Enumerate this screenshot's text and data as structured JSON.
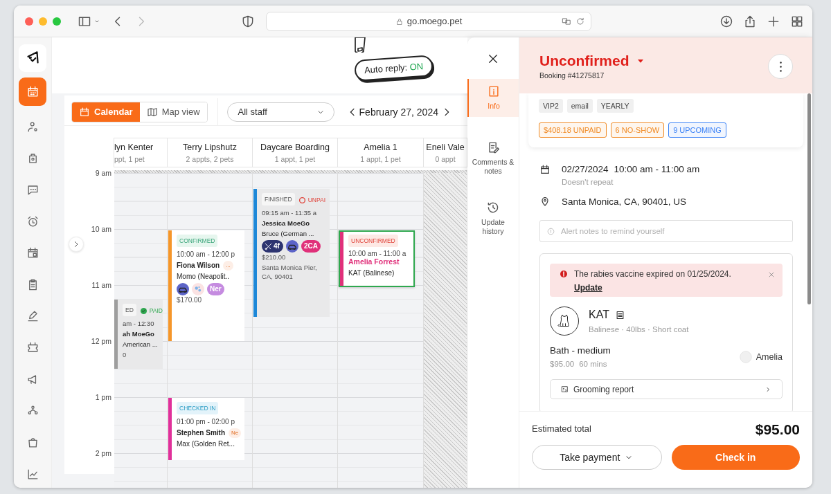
{
  "browser": {
    "url": "go.moego.pet"
  },
  "sidebar": {
    "items": [
      {
        "selected": true
      },
      {
        "selected": false
      },
      {
        "selected": false
      },
      {
        "selected": false
      },
      {
        "selected": false
      },
      {
        "selected": false
      },
      {
        "selected": false
      },
      {
        "selected": false
      },
      {
        "selected": false
      },
      {
        "selected": false
      },
      {
        "selected": false
      },
      {
        "selected": false
      },
      {
        "selected": false
      }
    ]
  },
  "auto_reply": {
    "label": "Auto reply:",
    "value": "ON",
    "on": true
  },
  "calendar": {
    "views": [
      {
        "label": "Calendar",
        "selected": true
      },
      {
        "label": "Map view",
        "selected": false
      }
    ],
    "staff_filter": "All staff",
    "date": "February 27, 2024",
    "hours": [
      "9 am",
      "10 am",
      "11 am",
      "12 pm",
      "1 pm",
      "2 pm"
    ],
    "columns": [
      {
        "name": "lyn Kenter",
        "summary": "ppt, 1 pet",
        "available": true,
        "events": [
          {
            "kind": "finished",
            "selected": false,
            "color": "#9e9e9e",
            "status": "ED",
            "payment": {
              "label": "PAID",
              "paid": true
            },
            "time": "am - 12:30",
            "client": "ah MoeGo",
            "highlight": false,
            "pet": "American ...",
            "price": "0"
          }
        ]
      },
      {
        "name": "Terry Lipshutz",
        "summary": "2 appts, 2 pets",
        "available": true,
        "events": [
          {
            "kind": "confirmed",
            "selected": false,
            "color": "#f5962a",
            "status": "CONFIRMED",
            "time": "10:00 am - 12:00 p",
            "client": "Fiona Wilson",
            "highlight": false,
            "client_tag": "...",
            "pet": "Momo (Neapolit..",
            "chips": [
              {
                "kind": "car"
              },
              {
                "kind": "bubbles"
              },
              {
                "kind": "tag",
                "label": "Ner",
                "color": "#c58be0"
              }
            ],
            "price": "$170.00"
          },
          {
            "kind": "checked_in",
            "selected": false,
            "color": "#e0309a",
            "status": "CHECKED IN",
            "time": "01:00 pm - 02:00 p",
            "client": "Stephen Smith",
            "highlight": false,
            "client_tag": "Ne",
            "pet": "Max (Golden Ret..."
          }
        ]
      },
      {
        "name": "Daycare Boarding",
        "summary": "1 appt, 1 pet",
        "available": true,
        "events": [
          {
            "kind": "finished",
            "selected": false,
            "color": "#1e88d8",
            "status": "FINISHED",
            "payment": {
              "label": "UNPAI",
              "paid": false
            },
            "time": "09:15 am - 11:35 a",
            "client": "Jessica MoeGo",
            "highlight": false,
            "pet": "Bruce (German ...",
            "chips": [
              {
                "kind": "groom",
                "label": "4f"
              },
              {
                "kind": "car"
              },
              {
                "kind": "tag",
                "label": "2CA",
                "color": "#e0307a"
              }
            ],
            "price": "$210.00",
            "address": "Santa Monica Pier, CA, 90401"
          }
        ]
      },
      {
        "name": "Amelia 1",
        "summary": "1 appt, 1 pet",
        "available": true,
        "events": [
          {
            "kind": "unconfirmed",
            "selected": true,
            "color": "#e0307a",
            "status": "UNCONFIRMED",
            "time": "10:00 am - 11:00 a",
            "client": "Amelia Forrest",
            "highlight": true,
            "pet": "KAT (Balinese)"
          }
        ]
      },
      {
        "name": "Eneli Vale",
        "summary": "0 appt",
        "available": false
      }
    ]
  },
  "drawer": {
    "tabs": [
      {
        "label": "Info",
        "selected": true
      },
      {
        "label": "Comments & notes",
        "selected": false
      },
      {
        "label": "Update history",
        "selected": false
      }
    ],
    "status": "Unconfirmed",
    "booking": "Booking #41275817",
    "client_tags": [
      "VIP2",
      "email",
      "YEARLY"
    ],
    "badges": [
      {
        "label": "$408.18 UNPAID",
        "color": "#f08a24"
      },
      {
        "label": "6 NO-SHOW",
        "color": "#f08a24"
      },
      {
        "label": "9 UPCOMING",
        "color": "#3b82f6"
      }
    ],
    "date": "02/27/2024",
    "time": "10:00 am - 11:00 am",
    "repeat": "Doesn't repeat",
    "location": "Santa Monica, CA, 90401, US",
    "alert_notes": {
      "placeholder": "Alert notes to remind yourself"
    },
    "pet": {
      "alert": "The rabies vaccine expired on 01/25/2024.",
      "alert_link": "Update",
      "name": "KAT",
      "details": "Balinese · 40lbs · Short coat",
      "service": "Bath - medium",
      "price": "$95.00",
      "duration": "60 mins",
      "staff": "Amelia",
      "report": "Grooming report"
    },
    "footer": {
      "total_label": "Estimated total",
      "total": "$95.00",
      "payment_button": "Take payment",
      "primary_button": "Check in"
    }
  }
}
